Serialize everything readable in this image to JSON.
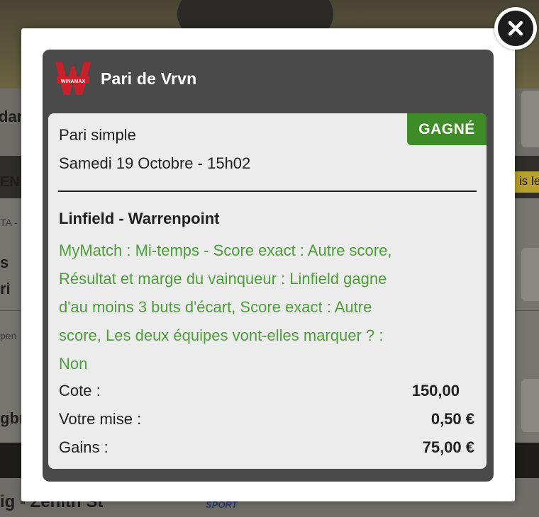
{
  "background": {
    "fragments": [
      "dar",
      "EN",
      "TA -",
      "s",
      "ri",
      "pen",
      "gbr",
      "is les",
      "ig - Zenith St",
      "SPORT"
    ]
  },
  "modal": {
    "close_icon": "close-icon",
    "header": {
      "logo_text": "WINAMAX",
      "title": "Pari de Vrvn"
    },
    "bet": {
      "status": "GAGNÉ",
      "status_color": "#3e8c28",
      "type": "Pari simple",
      "date": "Samedi 19 Octobre - 15h02",
      "match": "Linfield - Warrenpoint",
      "selection_color": "#4d9d3a",
      "selection_lines": [
        "MyMatch : Mi-temps - Score exact  : Autre score,",
        "Résultat et marge du vainqueur : Linfield gagne",
        "d'au moins 3 buts d'écart, Score exact : Autre",
        "score, Les deux équipes vont-elles marquer ? :",
        "Non"
      ],
      "odds_label": "Cote :",
      "odds_value": "150,00",
      "stake_label": "Votre mise :",
      "stake_value": "0,50 €",
      "winnings_label": "Gains :",
      "winnings_value": "75,00 €"
    }
  }
}
